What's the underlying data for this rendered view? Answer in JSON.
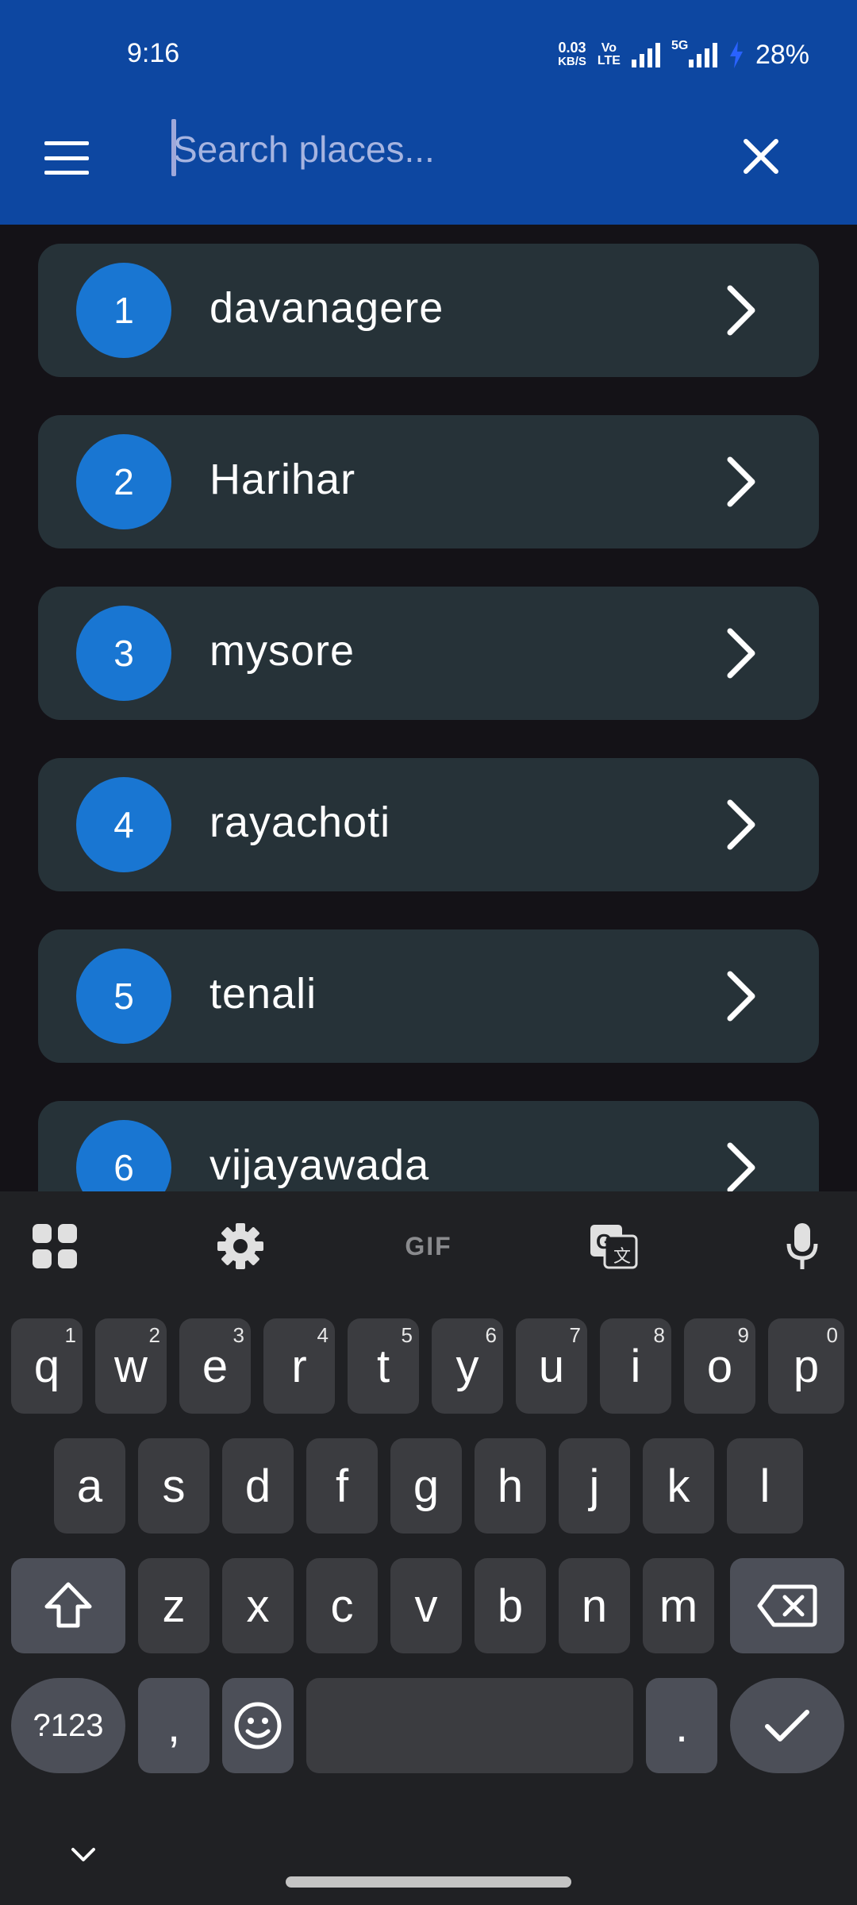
{
  "status_bar": {
    "time": "9:16",
    "net_speed_value": "0.03",
    "net_speed_unit": "KB/S",
    "volte_top": "Vo",
    "volte_bottom": "LTE",
    "network_type": "5G",
    "battery": "28%"
  },
  "header": {
    "search_placeholder": "Search places...",
    "search_value": ""
  },
  "places": [
    {
      "number": "1",
      "name": "davanagere"
    },
    {
      "number": "2",
      "name": "Harihar"
    },
    {
      "number": "3",
      "name": "mysore"
    },
    {
      "number": "4",
      "name": "rayachoti"
    },
    {
      "number": "5",
      "name": "tenali"
    },
    {
      "number": "6",
      "name": "vijayawada"
    }
  ],
  "keyboard": {
    "toolbar": {
      "gif_label": "GIF"
    },
    "row1": [
      {
        "key": "q",
        "hint": "1"
      },
      {
        "key": "w",
        "hint": "2"
      },
      {
        "key": "e",
        "hint": "3"
      },
      {
        "key": "r",
        "hint": "4"
      },
      {
        "key": "t",
        "hint": "5"
      },
      {
        "key": "y",
        "hint": "6"
      },
      {
        "key": "u",
        "hint": "7"
      },
      {
        "key": "i",
        "hint": "8"
      },
      {
        "key": "o",
        "hint": "9"
      },
      {
        "key": "p",
        "hint": "0"
      }
    ],
    "row2": [
      "a",
      "s",
      "d",
      "f",
      "g",
      "h",
      "j",
      "k",
      "l"
    ],
    "row3": [
      "z",
      "x",
      "c",
      "v",
      "b",
      "n",
      "m"
    ],
    "symbols_label": "?123",
    "comma": ",",
    "period": "."
  },
  "colors": {
    "app_bar": "#0d47a1",
    "background": "#141217",
    "card": "#263238",
    "badge": "#1976d2",
    "keyboard": "#202124",
    "key": "#3b3c40",
    "key_modifier": "#4c4f58"
  }
}
